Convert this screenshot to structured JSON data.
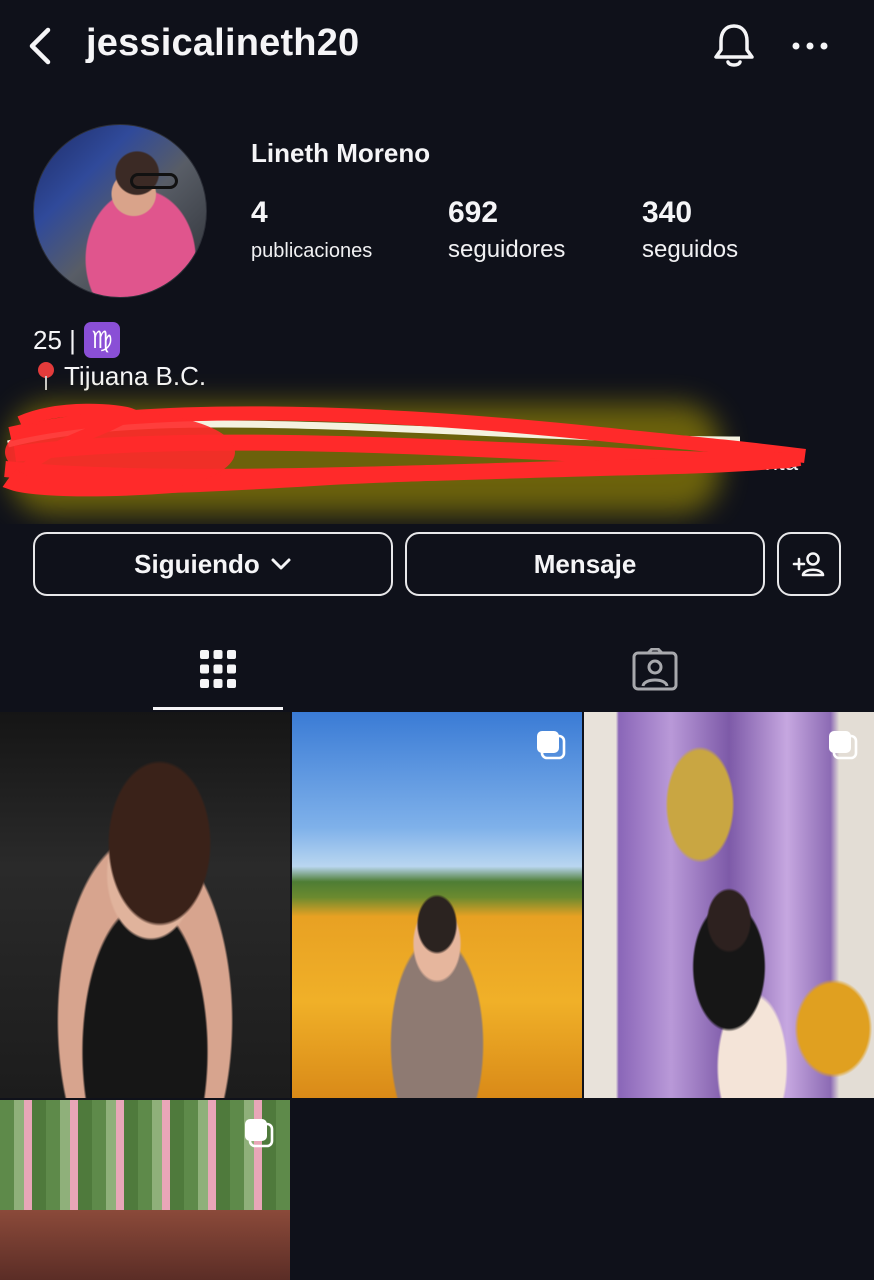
{
  "header": {
    "username": "jessicalineth20",
    "icons": {
      "back": "chevron-left-icon",
      "notifications": "bell-icon",
      "more": "more-horizontal-icon"
    }
  },
  "profile": {
    "full_name": "Lineth Moreno",
    "stats": [
      {
        "value": "4",
        "label": "publicaciones"
      },
      {
        "value": "692",
        "label": "seguidores"
      },
      {
        "value": "340",
        "label": "seguidos"
      }
    ],
    "bio": {
      "line1_text": "25 |",
      "line1_emoji": "♍",
      "line2_text": "Tijuana B.C.",
      "line3_partial": "uenta"
    }
  },
  "actions": {
    "following_label": "Siguiendo",
    "message_label": "Mensaje"
  },
  "tabs": [
    {
      "name": "posts-grid",
      "icon": "grid-icon",
      "active": true
    },
    {
      "name": "tagged",
      "icon": "tagged-person-icon",
      "active": false
    }
  ],
  "posts": [
    {
      "id": "post-1",
      "multiple": false
    },
    {
      "id": "post-2",
      "multiple": true
    },
    {
      "id": "post-3",
      "multiple": true
    },
    {
      "id": "post-4",
      "multiple": true
    }
  ],
  "colors": {
    "background": "#0f111a",
    "text": "#f5f5f7",
    "redaction": "#ff2a2a",
    "highlight": "#c9b400"
  }
}
